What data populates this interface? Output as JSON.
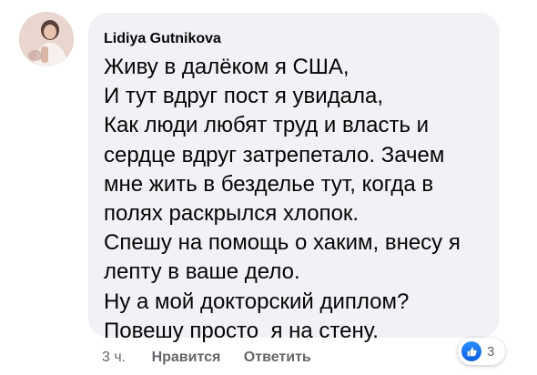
{
  "comment": {
    "author": "Lidiya Gutnikova",
    "lines": [
      "Живу в далёком я США,",
      "И тут вдруг пост я увидала,",
      "Как люди любят труд и власть и",
      "сердце вдруг затрепетало. Зачем",
      "мне жить в безделье тут, когда в",
      "полях раскрылся хлопок.",
      "Спешу на помощь о хаким, внесу я",
      "лепту в ваше дело.",
      "Ну а мой докторский диплом?",
      "Повешу просто  я на стену."
    ]
  },
  "actions": {
    "time": "3 ч.",
    "like_label": "Нравится",
    "reply_label": "Ответить"
  },
  "reactions": {
    "icon": "thumbs-up-icon",
    "count": "3",
    "color": "#1877f2"
  }
}
